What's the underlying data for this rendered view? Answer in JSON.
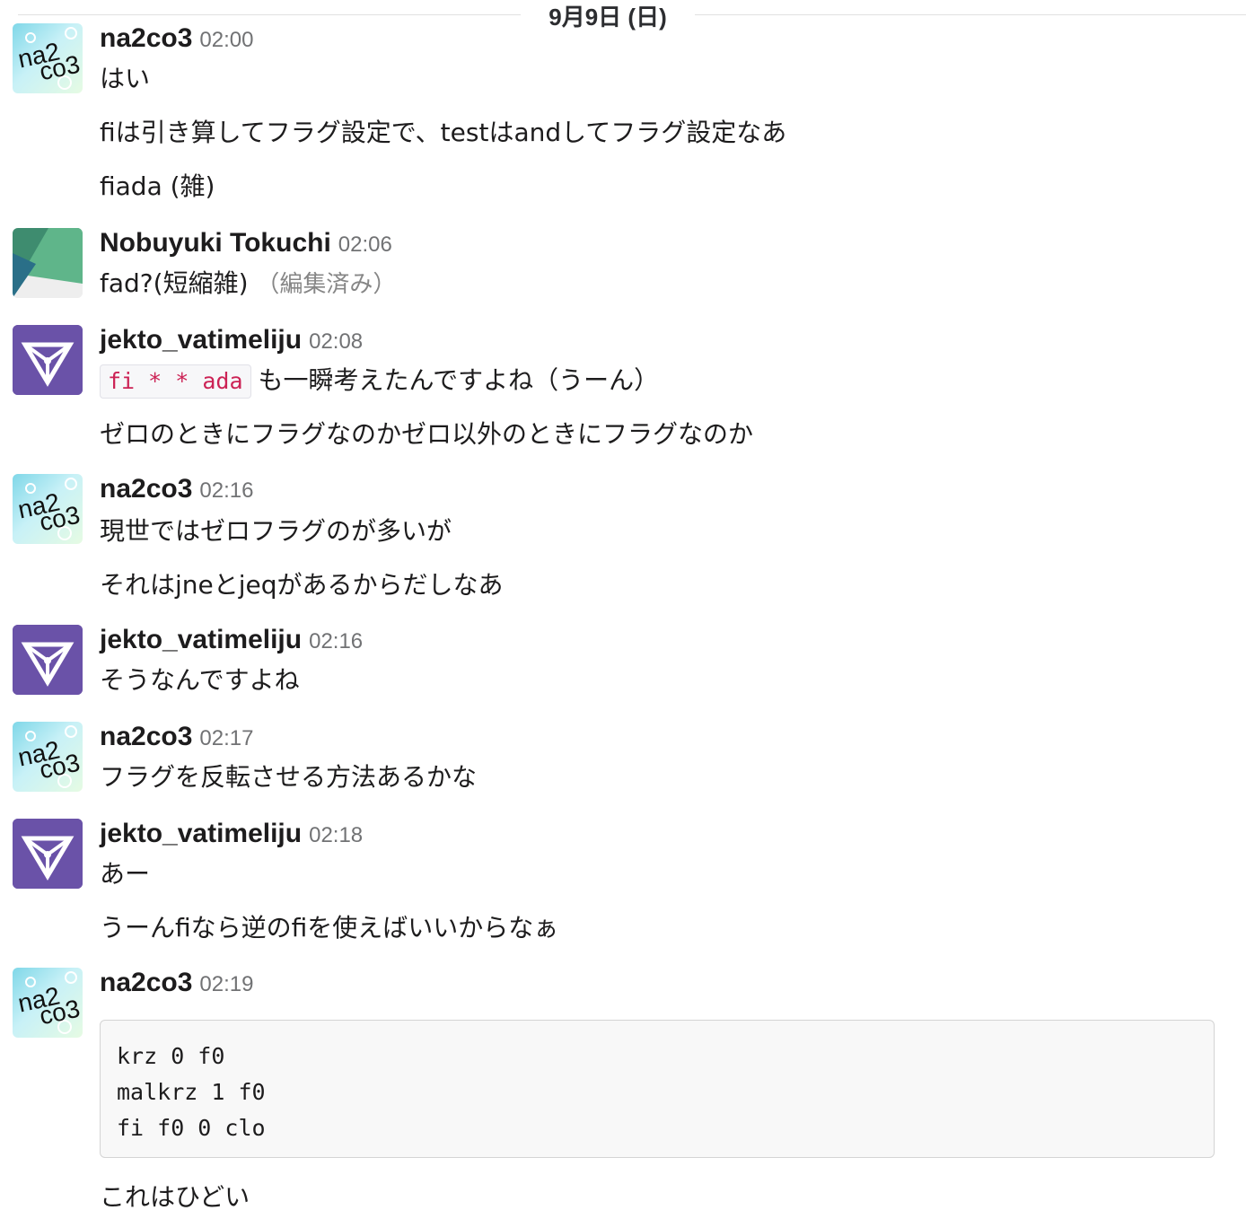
{
  "date_divider": "9月9日 (日)",
  "users": {
    "na2co3": {
      "name": "na2co3",
      "avatar_text_1": "na2",
      "avatar_text_2": "co3"
    },
    "tokuchi": {
      "name": "Nobuyuki Tokuchi"
    },
    "jekto": {
      "name": "jekto_vatimeliju"
    }
  },
  "messages": [
    {
      "user": "na2co3",
      "time": "02:00",
      "lines": [
        "はい",
        "fiは引き算してフラグ設定で、testはandしてフラグ設定なあ",
        "fiada (雑)"
      ]
    },
    {
      "user": "Nobuyuki Tokuchi",
      "time": "02:06",
      "lines": [
        "fad?(短縮雑)"
      ],
      "edited": "（編集済み）"
    },
    {
      "user": "jekto_vatimeliju",
      "time": "02:08",
      "inline_code": "fi * * ada",
      "lines": [
        "も一瞬考えたんですよね（うーん）",
        "ゼロのときにフラグなのかゼロ以外のときにフラグなのか"
      ]
    },
    {
      "user": "na2co3",
      "time": "02:16",
      "lines": [
        "現世ではゼロフラグのが多いが",
        "それはjneとjeqがあるからだしなあ"
      ]
    },
    {
      "user": "jekto_vatimeliju",
      "time": "02:16",
      "lines": [
        "そうなんですよね"
      ]
    },
    {
      "user": "na2co3",
      "time": "02:17",
      "lines": [
        "フラグを反転させる方法あるかな"
      ]
    },
    {
      "user": "jekto_vatimeliju",
      "time": "02:18",
      "lines": [
        "あー",
        "うーんfiなら逆のfiを使えばいいからなぁ"
      ]
    },
    {
      "user": "na2co3",
      "time": "02:19",
      "code_block": [
        "krz 0 f0",
        "malkrz 1 f0",
        "fi f0 0 clo"
      ],
      "lines": [
        "これはひどい"
      ]
    }
  ],
  "colors": {
    "text": "#1d1c1d",
    "timestamp": "#717274",
    "inline_code": "#cc2255",
    "jekto_avatar": "#6a52a8",
    "tokuchi_green_dark": "#2e8a6a",
    "tokuchi_green_light": "#5fb58a"
  }
}
